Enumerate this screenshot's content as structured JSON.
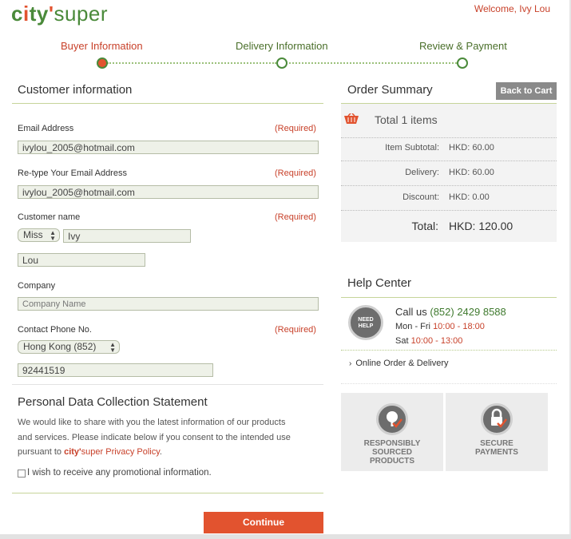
{
  "header": {
    "logo": {
      "c": "c",
      "i": "i",
      "ty": "ty",
      "apos": "'",
      "super": "super"
    },
    "welcome": "Welcome, Ivy Lou"
  },
  "steps": [
    {
      "label": "Buyer Information",
      "active": true
    },
    {
      "label": "Delivery Information",
      "active": false
    },
    {
      "label": "Review & Payment",
      "active": false
    }
  ],
  "customer": {
    "title": "Customer information",
    "required": "(Required)",
    "email_label": "Email Address",
    "email_value": "ivylou_2005@hotmail.com",
    "retype_label": "Re-type Your Email Address",
    "retype_value": "ivylou_2005@hotmail.com",
    "name_label": "Customer name",
    "salutation": "Miss",
    "first_name": "Ivy",
    "last_name": "Lou",
    "company_label": "Company",
    "company_placeholder": "Company Name",
    "phone_label": "Contact Phone No.",
    "phone_country": "Hong Kong (852)",
    "phone_value": "92441519"
  },
  "pdc": {
    "title": "Personal Data Collection Statement",
    "line1": "We would like to share with you the latest information of our products",
    "line2": "and services. Please indicate below if you consent to the intended use",
    "line3_pre": "pursuant to ",
    "brand_city": "city'",
    "brand_super": "super",
    "policy": " Privacy Policy",
    "line3_post": ".",
    "checkbox_label": "I wish to receive any promotional information."
  },
  "continue_label": "Continue",
  "summary": {
    "title": "Order Summary",
    "back_label": "Back to Cart",
    "total_prefix": "Total ",
    "total_count": "1",
    "total_suffix": " items",
    "rows": [
      {
        "label": "Item Subtotal:",
        "value": "HKD: 60.00"
      },
      {
        "label": "Delivery:",
        "value": "HKD: 60.00"
      },
      {
        "label": "Discount:",
        "value": "HKD: 0.00"
      }
    ],
    "grand_label": "Total:",
    "grand_value": "HKD: 120.00"
  },
  "help": {
    "title": "Help Center",
    "icon_line1": "NEED",
    "icon_line2": "HELP",
    "call_label": "Call us ",
    "call_number": "(852) 2429 8588",
    "weekday_label": "Mon - Fri ",
    "weekday_hours": "10:00 - 18:00",
    "sat_label": "Sat ",
    "sat_hours": "10:00 - 13:00",
    "link": "Online Order & Delivery"
  },
  "features": [
    {
      "l1": "RESPONSIBLY",
      "l2": "SOURCED",
      "l3": "PRODUCTS",
      "icon": "tree-icon"
    },
    {
      "l1": "SECURE",
      "l2": "PAYMENTS",
      "l3": "",
      "icon": "lock-icon"
    }
  ],
  "colors": {
    "accent": "#e2532f",
    "brand_green": "#4a8a3a",
    "rule": "#c6d49a"
  }
}
